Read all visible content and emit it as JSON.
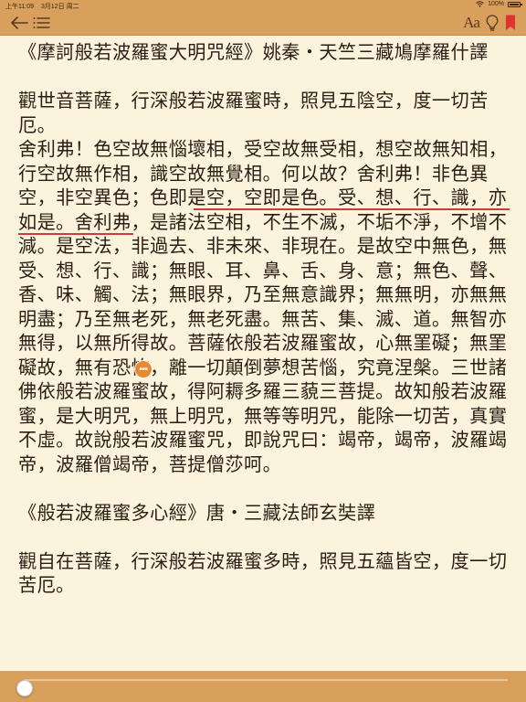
{
  "status_bar": {
    "time": "上午11:09",
    "date": "3月12日 周二",
    "battery": "100%"
  },
  "toolbar": {
    "back_icon": "back-arrow-icon",
    "toc_icon": "table-of-contents-icon",
    "font_label": "Aa",
    "brightness_icon": "lightbulb-icon",
    "bookmark_icon": "bookmark-icon",
    "accent_color": "#d99f5c",
    "bookmark_color": "#e0322f"
  },
  "reader": {
    "background": "#fbf3dc",
    "title1": "《摩訶般若波羅蜜大明咒經》姚秦・天竺三藏鳩摩羅什譯",
    "para1": "觀世音菩薩，行深般若波羅蜜時，照見五陰空，度一切苦厄。",
    "para2_prefix": "舍利弗！色空故無惱壞相，受空故無受相，想空故無知相，行空故無作相，識空故無覺相。何以故？舍利弗！非色異空，非空異色；",
    "para2_highlight": "色即是空，空即是色。受、想、行、識，亦如是。",
    "para2_suffix": "舍利弗，是諸法空相，不生不滅，不垢不淨，不增不減。是空法，非過去、非未來、非現在。是故空中無色，無受、想、行、識；無眼、耳、鼻、舌、身、意；無色、聲、香、味、觸、法；無眼界，乃至無意識界；無無明，亦無無明盡；乃至無老死，無老死盡。無苦、集、滅、道。無智亦無得，以無所得故。菩薩依般若波羅蜜故，心無罣礙；無罣礙故，無有恐怖，離一切顛倒夢想苦惱，究竟涅槃。三世諸佛依般若波羅蜜故，得阿耨多羅三藐三菩提。故知般若波羅蜜，是大明咒，無上明咒，無等等明咒，能除一切苦，真實不虛。故說般若波羅蜜咒，即說咒曰：竭帝，竭帝，波羅竭帝，波羅僧竭帝，菩提僧莎呵。",
    "title2": "《般若波羅蜜多心經》唐・三藏法師玄奘譯",
    "para3": "觀自在菩薩，行深般若波羅蜜多時，照見五蘊皆空，度一切苦厄。",
    "note_marker": "•••",
    "highlight_color": "#d13a3a"
  },
  "progress": {
    "fraction": 0.0,
    "track_color": "#e9c89a"
  }
}
